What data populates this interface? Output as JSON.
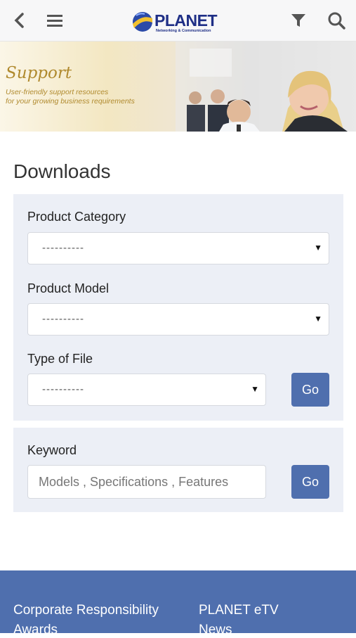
{
  "header": {
    "back_icon": "chevron-left-icon",
    "menu_icon": "hamburger-menu-icon",
    "logo_text": "PLANET",
    "logo_tagline": "Networking & Communication",
    "filter_icon": "filter-icon",
    "search_icon": "search-icon"
  },
  "banner": {
    "title": "Support",
    "subtitle_line1": "User-friendly support resources",
    "subtitle_line2": "for your growing business requirements"
  },
  "page": {
    "title": "Downloads"
  },
  "filters": {
    "product_category": {
      "label": "Product Category",
      "value": "----------"
    },
    "product_model": {
      "label": "Product Model",
      "value": "----------"
    },
    "type_of_file": {
      "label": "Type of File",
      "value": "----------"
    },
    "go_label": "Go"
  },
  "keyword": {
    "label": "Keyword",
    "placeholder": "Models , Specifications , Features",
    "go_label": "Go"
  },
  "footer": {
    "links": [
      "Corporate Responsibility",
      "PLANET eTV",
      "Awards",
      "News"
    ]
  },
  "colors": {
    "accent": "#4f6fae",
    "panel": "#eceff6",
    "logo": "#1f2f86",
    "banner_text": "#b08a2e"
  }
}
